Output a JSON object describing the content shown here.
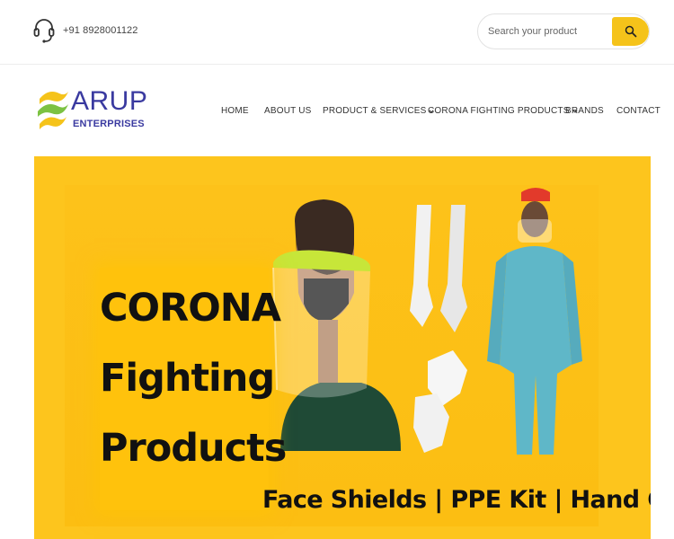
{
  "topbar": {
    "phone": "+91 8928001122",
    "search": {
      "placeholder": "Search your product"
    }
  },
  "brand": {
    "name": "ARUP",
    "subtitle": "ENTERPRISES",
    "color": "#3a3aa0",
    "accent_colors": [
      "#f5c31a",
      "#7cc242"
    ]
  },
  "nav": {
    "items": [
      {
        "label": "HOME",
        "has_dropdown": false
      },
      {
        "label": "ABOUT US",
        "has_dropdown": false
      },
      {
        "label": "PRODUCT & SERVICES",
        "has_dropdown": true
      },
      {
        "label": "CORONA FIGHTING PRODUCTS",
        "has_dropdown": true
      },
      {
        "label": "BRANDS",
        "has_dropdown": false
      },
      {
        "label": "CONTACT",
        "has_dropdown": false
      }
    ]
  },
  "banner": {
    "headline_lines": [
      "CORONA",
      "Fighting",
      "Products"
    ],
    "tagline": "Face Shields | PPE Kit | Hand Gloves",
    "background_color": "#fdc51d"
  },
  "icons": {
    "phone": "headset-icon",
    "search": "search-icon",
    "dropdown": "chevron-down-icon"
  }
}
